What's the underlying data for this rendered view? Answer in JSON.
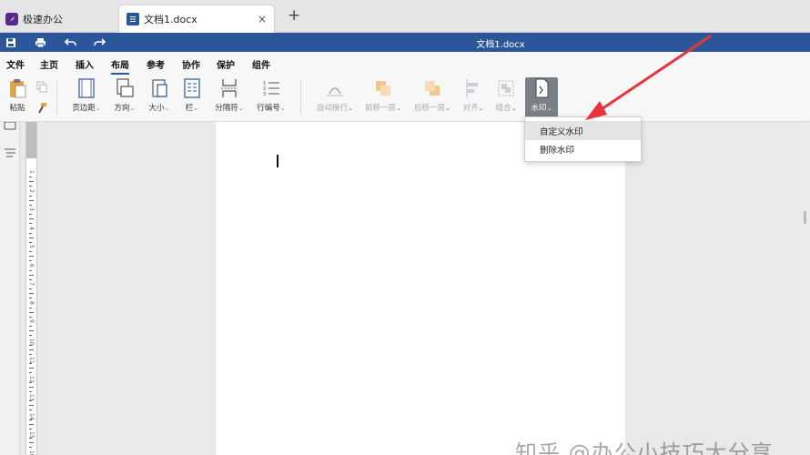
{
  "tabs": {
    "home": {
      "label": "极速办公"
    },
    "doc": {
      "label": "文档1.docx",
      "close": "×"
    },
    "new_tab": "+"
  },
  "titlebar": {
    "title": "文档1.docx"
  },
  "menu": {
    "items": [
      "文件",
      "主页",
      "插入",
      "布局",
      "参考",
      "协作",
      "保护",
      "组件"
    ],
    "active": "布局"
  },
  "ribbon": {
    "paste": "粘贴",
    "margins": "页边距",
    "orientation": "方向",
    "size": "大小",
    "columns": "栏",
    "breaks": "分隔符",
    "line_numbers": "行编号",
    "wrap": "自动换行",
    "bring_forward": "前移一层",
    "send_backward": "后移一层",
    "align": "对齐",
    "group": "组合",
    "watermark": "水印",
    "caret": "⌄"
  },
  "dropdown": {
    "items": [
      "自定义水印",
      "删除水印"
    ]
  },
  "ruler": {
    "numbers": [
      "1",
      "2",
      "3",
      "4",
      "5",
      "6",
      "7",
      "8",
      "9",
      "10",
      "11",
      "12",
      "13",
      "14",
      "15",
      "16"
    ]
  },
  "watermark_text": "知乎 @办公小技巧大分享",
  "colors": {
    "accent": "#2b579a",
    "arrow": "#e8343a",
    "selected": "#7a7f88"
  }
}
